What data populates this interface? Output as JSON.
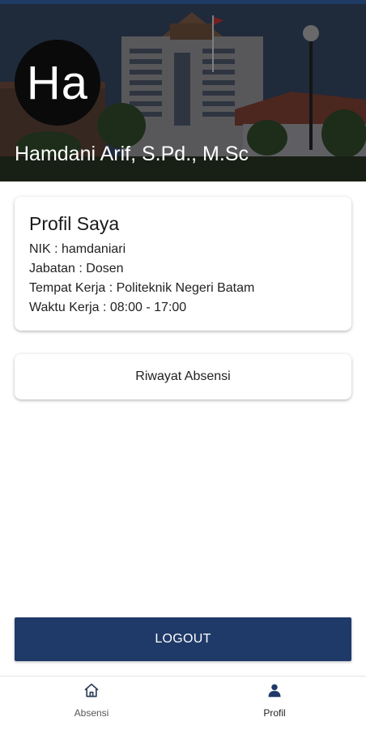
{
  "header": {
    "avatar_initials": "Ha",
    "user_name": "Hamdani Arif, S.Pd., M.Sc"
  },
  "profile_card": {
    "title": "Profil Saya",
    "nik": "NIK : hamdaniari",
    "jabatan": "Jabatan : Dosen",
    "tempat_kerja": "Tempat Kerja : Politeknik Negeri Batam",
    "waktu_kerja": "Waktu Kerja : 08:00 - 17:00"
  },
  "history_button": {
    "label": "Riwayat Absensi"
  },
  "logout_button": {
    "label": "LOGOUT"
  },
  "bottom_nav": {
    "items": [
      {
        "label": "Absensi",
        "icon": "home-icon",
        "active": false
      },
      {
        "label": "Profil",
        "icon": "person-icon",
        "active": true
      }
    ]
  },
  "colors": {
    "primary": "#1f3a68",
    "header_overlay": "#2a3a55",
    "text": "#1a1a1a"
  }
}
